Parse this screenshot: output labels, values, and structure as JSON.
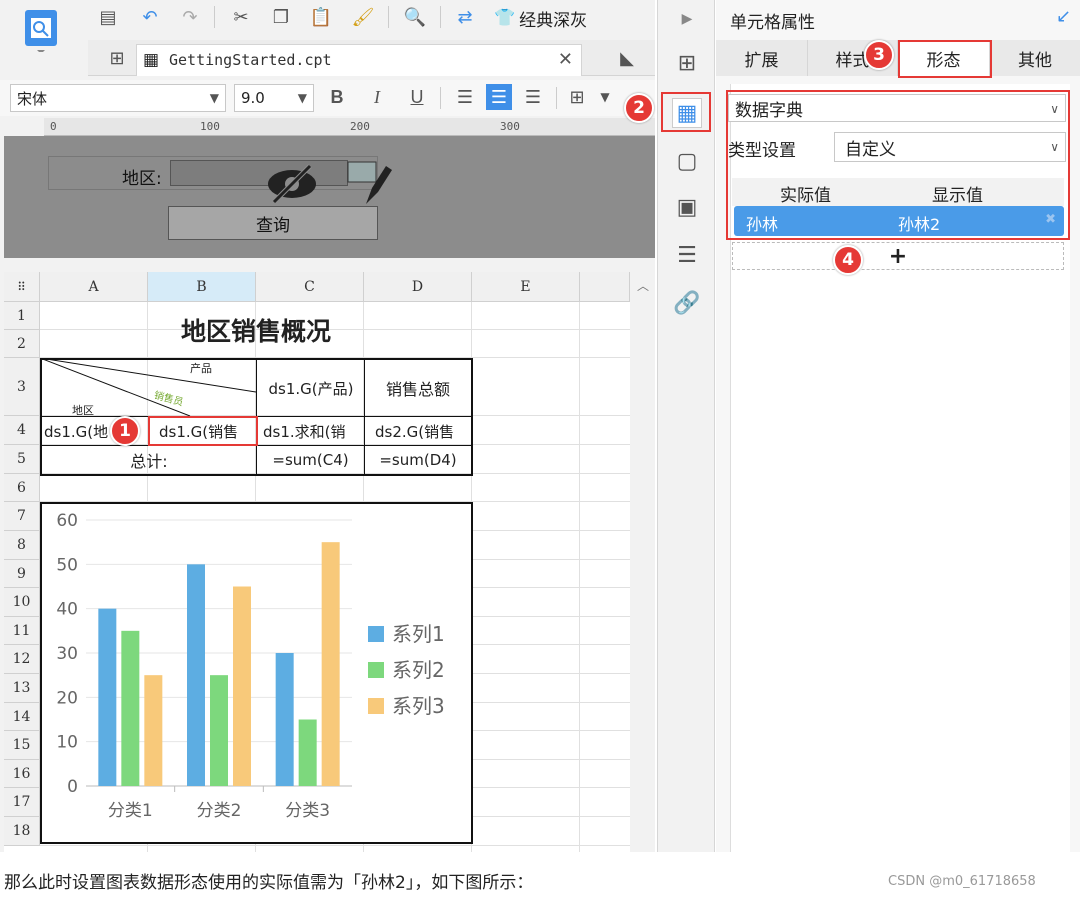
{
  "toolbar": {
    "theme_label": "经典深灰"
  },
  "file_tab": {
    "name": "GettingStarted.cpt"
  },
  "font_bar": {
    "font_name": "宋体",
    "font_size": "9.0"
  },
  "ruler": {
    "ticks": [
      "0",
      "100",
      "200",
      "300"
    ]
  },
  "param_pane": {
    "region_label": "地区:",
    "query_button": "查询"
  },
  "grid": {
    "columns": [
      "A",
      "B",
      "C",
      "D",
      "E"
    ],
    "rows": [
      "1",
      "2",
      "3",
      "4",
      "5",
      "6",
      "7",
      "8",
      "9",
      "10",
      "11",
      "12",
      "13",
      "14",
      "15",
      "16",
      "17",
      "18"
    ],
    "title": "地区销售概况",
    "diag_product": "产品",
    "diag_sales": "销售员",
    "diag_region": "地区",
    "c3": "ds1.G(产品)",
    "d3": "销售总额",
    "a4": "ds1.G(地",
    "b4": "ds1.G(销售",
    "c4": "ds1.求和(销",
    "d4": "ds2.G(销售",
    "a5": "总计:",
    "c5": "=sum(C4)",
    "d5": "=sum(D4)"
  },
  "chart_data": {
    "type": "bar",
    "categories": [
      "分类1",
      "分类2",
      "分类3"
    ],
    "series": [
      {
        "name": "系列1",
        "values": [
          40,
          50,
          30
        ],
        "color": "#5dade2"
      },
      {
        "name": "系列2",
        "values": [
          35,
          25,
          15
        ],
        "color": "#7dd87d"
      },
      {
        "name": "系列3",
        "values": [
          25,
          45,
          55
        ],
        "color": "#f8c97a"
      }
    ],
    "yticks": [
      "0",
      "10",
      "20",
      "30",
      "40",
      "50",
      "60"
    ],
    "ylim": [
      0,
      60
    ],
    "legend_position": "right",
    "grid": true
  },
  "panel": {
    "title": "单元格属性",
    "tabs": [
      "扩展",
      "样式",
      "形态",
      "其他"
    ],
    "form_type": "数据字典",
    "type_setting_label": "类型设置",
    "type_setting_value": "自定义",
    "col_actual": "实际值",
    "col_display": "显示值",
    "row_actual": "孙林",
    "row_display": "孙林2",
    "add_label": "+"
  },
  "markers": [
    "1",
    "2",
    "3",
    "4"
  ],
  "footer": {
    "caption": "那么此时设置图表数据形态使用的实际值需为「孙林2」，如下图所示：",
    "watermark": "CSDN @m0_61718658"
  },
  "colors": {
    "accent": "#3f8fe8",
    "marker": "#e53935",
    "selected_row": "#4a9be8"
  }
}
